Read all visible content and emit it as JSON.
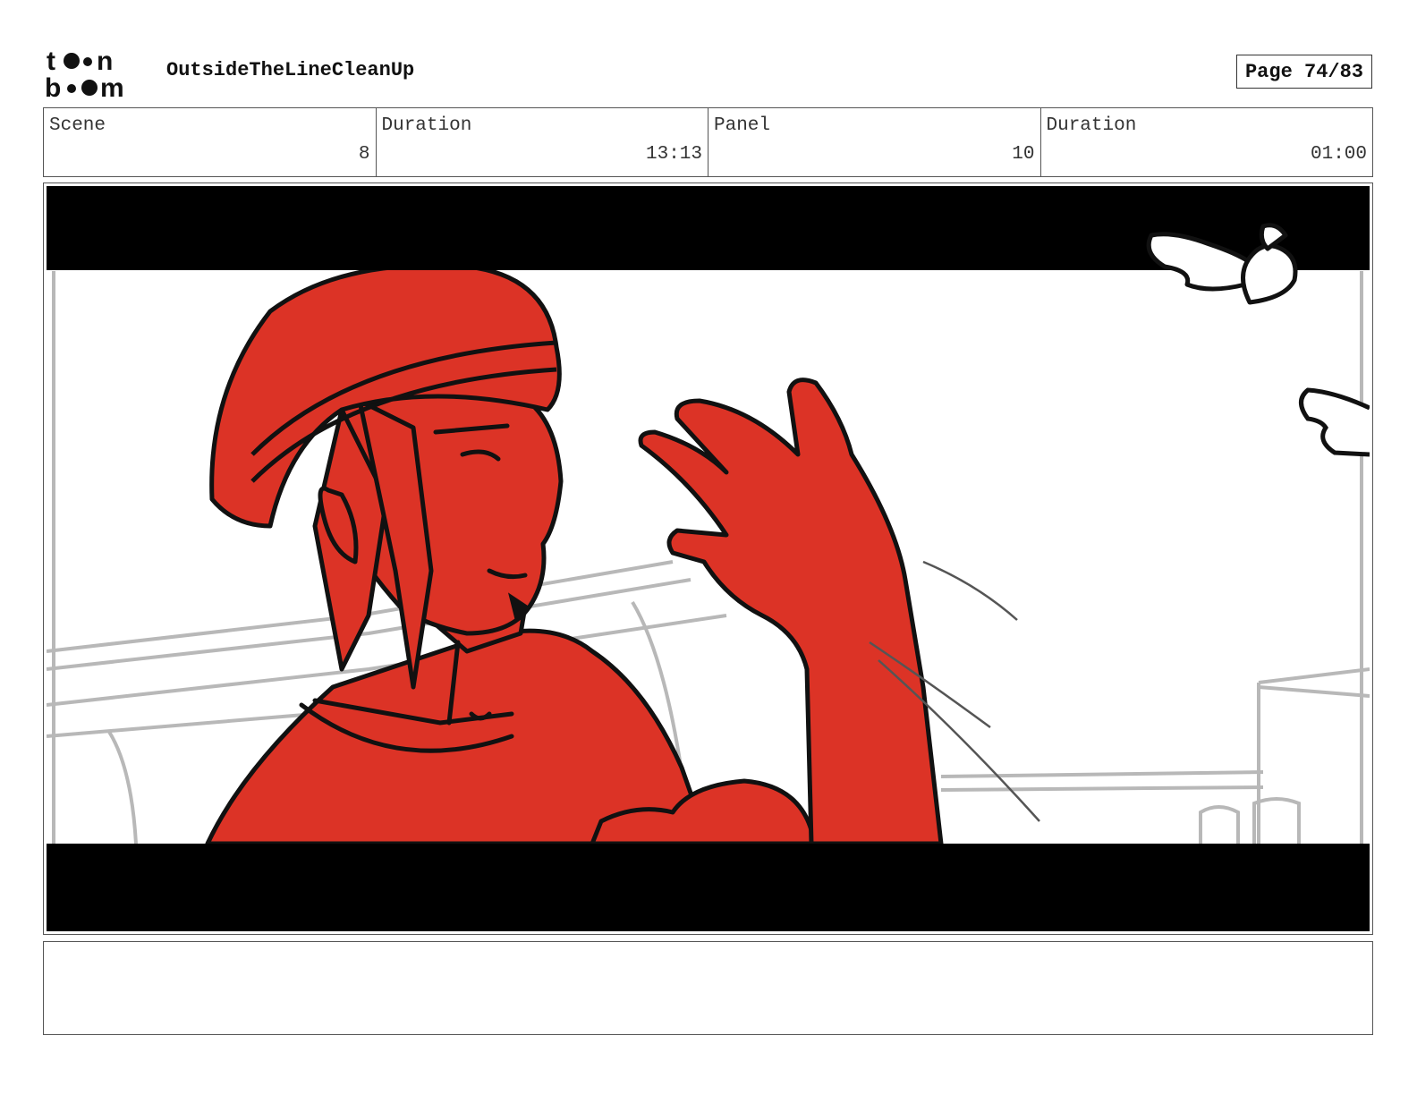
{
  "header": {
    "logo_text": "toonboom",
    "project_title": "OutsideTheLineCleanUp",
    "page_label": "Page 74/83"
  },
  "info": [
    {
      "label": "Scene",
      "value": "8"
    },
    {
      "label": "Duration",
      "value": "13:13"
    },
    {
      "label": "Panel",
      "value": "10"
    },
    {
      "label": "Duration",
      "value": "01:00"
    }
  ],
  "colors": {
    "character_fill": "#dc3326",
    "letterbox": "#000000",
    "sketch_lines": "#b8b8b8"
  },
  "notes": {
    "text": ""
  }
}
